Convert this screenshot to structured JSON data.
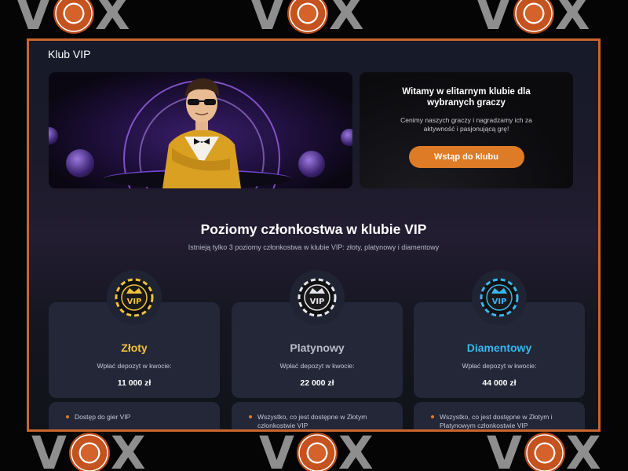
{
  "watermark": {
    "text_left": "V",
    "text_right": "X"
  },
  "page": {
    "title": "Klub VIP"
  },
  "hero": {
    "welcome_title": "Witamy w elitarnym klubie dla wybranych graczy",
    "welcome_subtitle": "Cenimy naszych graczy i nagradzamy ich za aktywność i pasjonującą grę!",
    "join_button": "Wstąp do klubu"
  },
  "levels": {
    "title": "Poziomy członkostwa w klubie VIP",
    "subtitle": "Istnieją tylko 3 poziomy członkostwa w klubie VIP: złoty, platynowy i diamentowy",
    "tiers": [
      {
        "name": "Złoty",
        "deposit_label": "Wpłać depozyt w kwocie:",
        "amount": "11 000 zł",
        "color": "#f0c23a",
        "badge_text": "VIP",
        "perk": "Dostęp do gier VIP"
      },
      {
        "name": "Platynowy",
        "deposit_label": "Wpłać depozyt w kwocie:",
        "amount": "22 000 zł",
        "color": "#b9bcc8",
        "badge_text": "VIP",
        "perk": "Wszystko, co jest dostępne w Złotym członkostwie VIP"
      },
      {
        "name": "Diamentowy",
        "deposit_label": "Wpłać depozyt w kwocie:",
        "amount": "44 000 zł",
        "color": "#39b6ef",
        "badge_text": "VIP",
        "perk": "Wszystko, co jest dostępne w Złotym i Platynowym członkostwie VIP"
      }
    ]
  },
  "colors": {
    "accent": "#dd7b27",
    "frame_border": "#c9652e",
    "card_bg": "#232738"
  }
}
